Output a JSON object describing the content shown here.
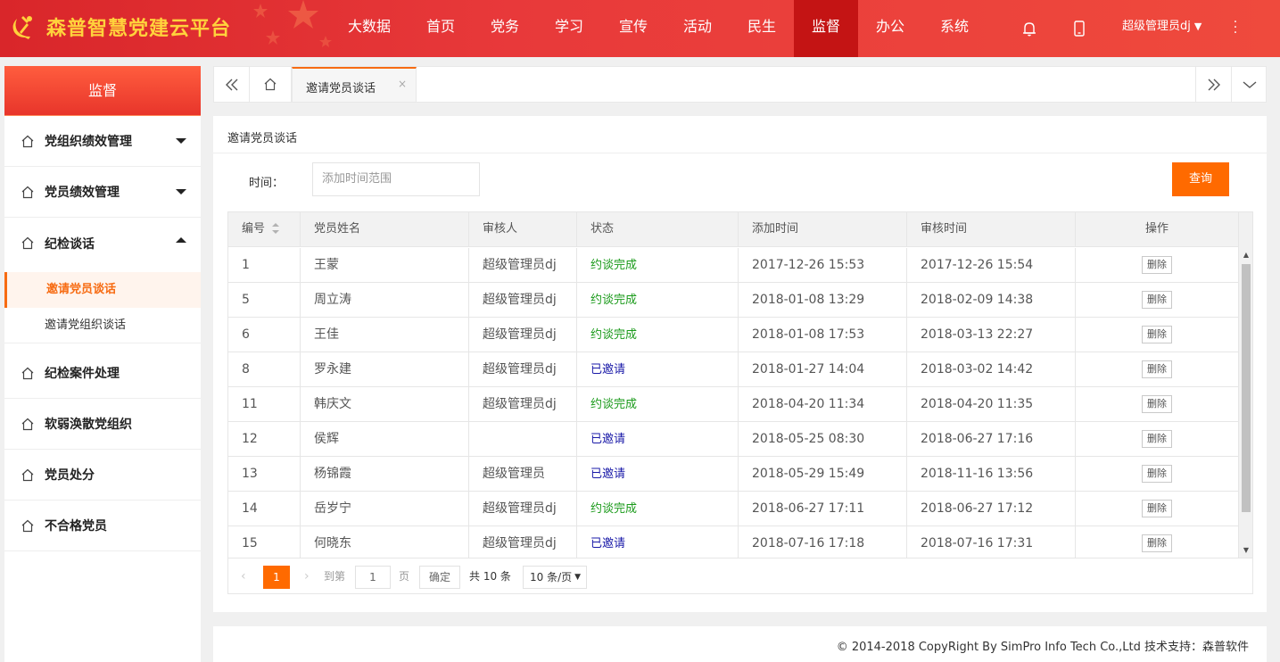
{
  "header": {
    "logo_text": "森普智慧党建云平台",
    "nav": [
      {
        "label": "大数据"
      },
      {
        "label": "首页"
      },
      {
        "label": "党务"
      },
      {
        "label": "学习"
      },
      {
        "label": "宣传"
      },
      {
        "label": "活动"
      },
      {
        "label": "民生"
      },
      {
        "label": "监督",
        "active": true
      },
      {
        "label": "办公"
      },
      {
        "label": "系统"
      }
    ],
    "icons": [
      "bell-icon",
      "mobile-icon"
    ],
    "user": "超级管理员dj"
  },
  "sidebar": {
    "title": "监督",
    "items": [
      {
        "label": "党组织绩效管理",
        "expanded": false
      },
      {
        "label": "党员绩效管理",
        "expanded": false
      },
      {
        "label": "纪检谈话",
        "expanded": true
      },
      {
        "label": "纪检案件处理"
      },
      {
        "label": "软弱涣散党组织"
      },
      {
        "label": "党员处分"
      },
      {
        "label": "不合格党员"
      }
    ],
    "subitems": [
      {
        "label": "邀请党员谈话",
        "active": true
      },
      {
        "label": "邀请党组织谈话"
      }
    ]
  },
  "tabs": {
    "active_tab": "邀请党员谈话",
    "close": "×"
  },
  "main": {
    "title": "邀请党员谈话",
    "filter_label": "时间：",
    "filter_placeholder": "添加时间范围",
    "query_button": "查询"
  },
  "table": {
    "columns": [
      "编号",
      "党员姓名",
      "审核人",
      "状态",
      "添加时间",
      "审核时间",
      "操作"
    ],
    "delete_label": "删除",
    "rows": [
      {
        "id": "1",
        "name": "王蒙",
        "reviewer": "超级管理员dj",
        "status": "约谈完成",
        "added": "2017-12-26 15:53",
        "reviewed": "2017-12-26 15:54"
      },
      {
        "id": "5",
        "name": "周立涛",
        "reviewer": "超级管理员dj",
        "status": "约谈完成",
        "added": "2018-01-08 13:29",
        "reviewed": "2018-02-09 14:38"
      },
      {
        "id": "6",
        "name": "王佳",
        "reviewer": "超级管理员dj",
        "status": "约谈完成",
        "added": "2018-01-08 17:53",
        "reviewed": "2018-03-13 22:27"
      },
      {
        "id": "8",
        "name": "罗永建",
        "reviewer": "超级管理员dj",
        "status": "已邀请",
        "added": "2018-01-27 14:04",
        "reviewed": "2018-03-02 14:42"
      },
      {
        "id": "11",
        "name": "韩庆文",
        "reviewer": "超级管理员dj",
        "status": "约谈完成",
        "added": "2018-04-20 11:34",
        "reviewed": "2018-04-20 11:35"
      },
      {
        "id": "12",
        "name": "侯辉",
        "reviewer": "",
        "status": "已邀请",
        "added": "2018-05-25 08:30",
        "reviewed": "2018-06-27 17:16"
      },
      {
        "id": "13",
        "name": "杨锦霞",
        "reviewer": "超级管理员",
        "status": "已邀请",
        "added": "2018-05-29 15:49",
        "reviewed": "2018-11-16 13:56"
      },
      {
        "id": "14",
        "name": "岳岁宁",
        "reviewer": "超级管理员dj",
        "status": "约谈完成",
        "added": "2018-06-27 17:11",
        "reviewed": "2018-06-27 17:12"
      },
      {
        "id": "15",
        "name": "何晓东",
        "reviewer": "超级管理员dj",
        "status": "已邀请",
        "added": "2018-07-16 17:18",
        "reviewed": "2018-07-16 17:31"
      }
    ]
  },
  "pager": {
    "prev": "‹",
    "current": "1",
    "next": "›",
    "goto_label": "到第",
    "goto_value": "1",
    "page_unit": "页",
    "confirm": "确定",
    "total": "共 10 条",
    "page_size": "10 条/页"
  },
  "footer": {
    "text": "© 2014-2018 CopyRight By SimPro Info Tech Co.,Ltd 技术支持：森普软件"
  },
  "colors": {
    "header_red": "#e8393a",
    "active_nav": "#c41414",
    "accent_orange": "#ff6a00",
    "status_done": "#1a9a1a",
    "status_invited": "#1a1aa8"
  }
}
